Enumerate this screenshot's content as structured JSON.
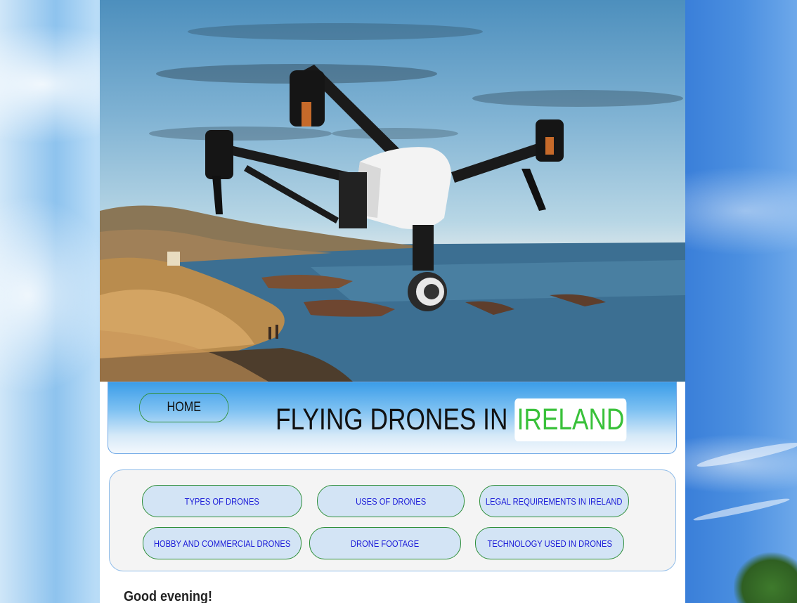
{
  "header": {
    "home_label": "HOME",
    "title_main": "FLYING DRONES IN",
    "title_highlight": "IRELAND"
  },
  "nav": {
    "items": [
      {
        "label": "TYPES OF DRONES"
      },
      {
        "label": "USES OF DRONES"
      },
      {
        "label": "LEGAL REQUIREMENTS IN IRELAND"
      },
      {
        "label": "HOBBY AND COMMERCIAL DRONES"
      },
      {
        "label": "DRONE FOOTAGE"
      },
      {
        "label": "TECHNOLOGY USED IN DRONES"
      }
    ]
  },
  "content": {
    "greeting": "Good evening!"
  },
  "colors": {
    "title_highlight": "#39c13a",
    "nav_text": "#1b1bd8",
    "nav_border": "#2f8f3a",
    "nav_fill": "#d3e4f5"
  },
  "hero": {
    "image_subject": "drone-over-coastline"
  }
}
